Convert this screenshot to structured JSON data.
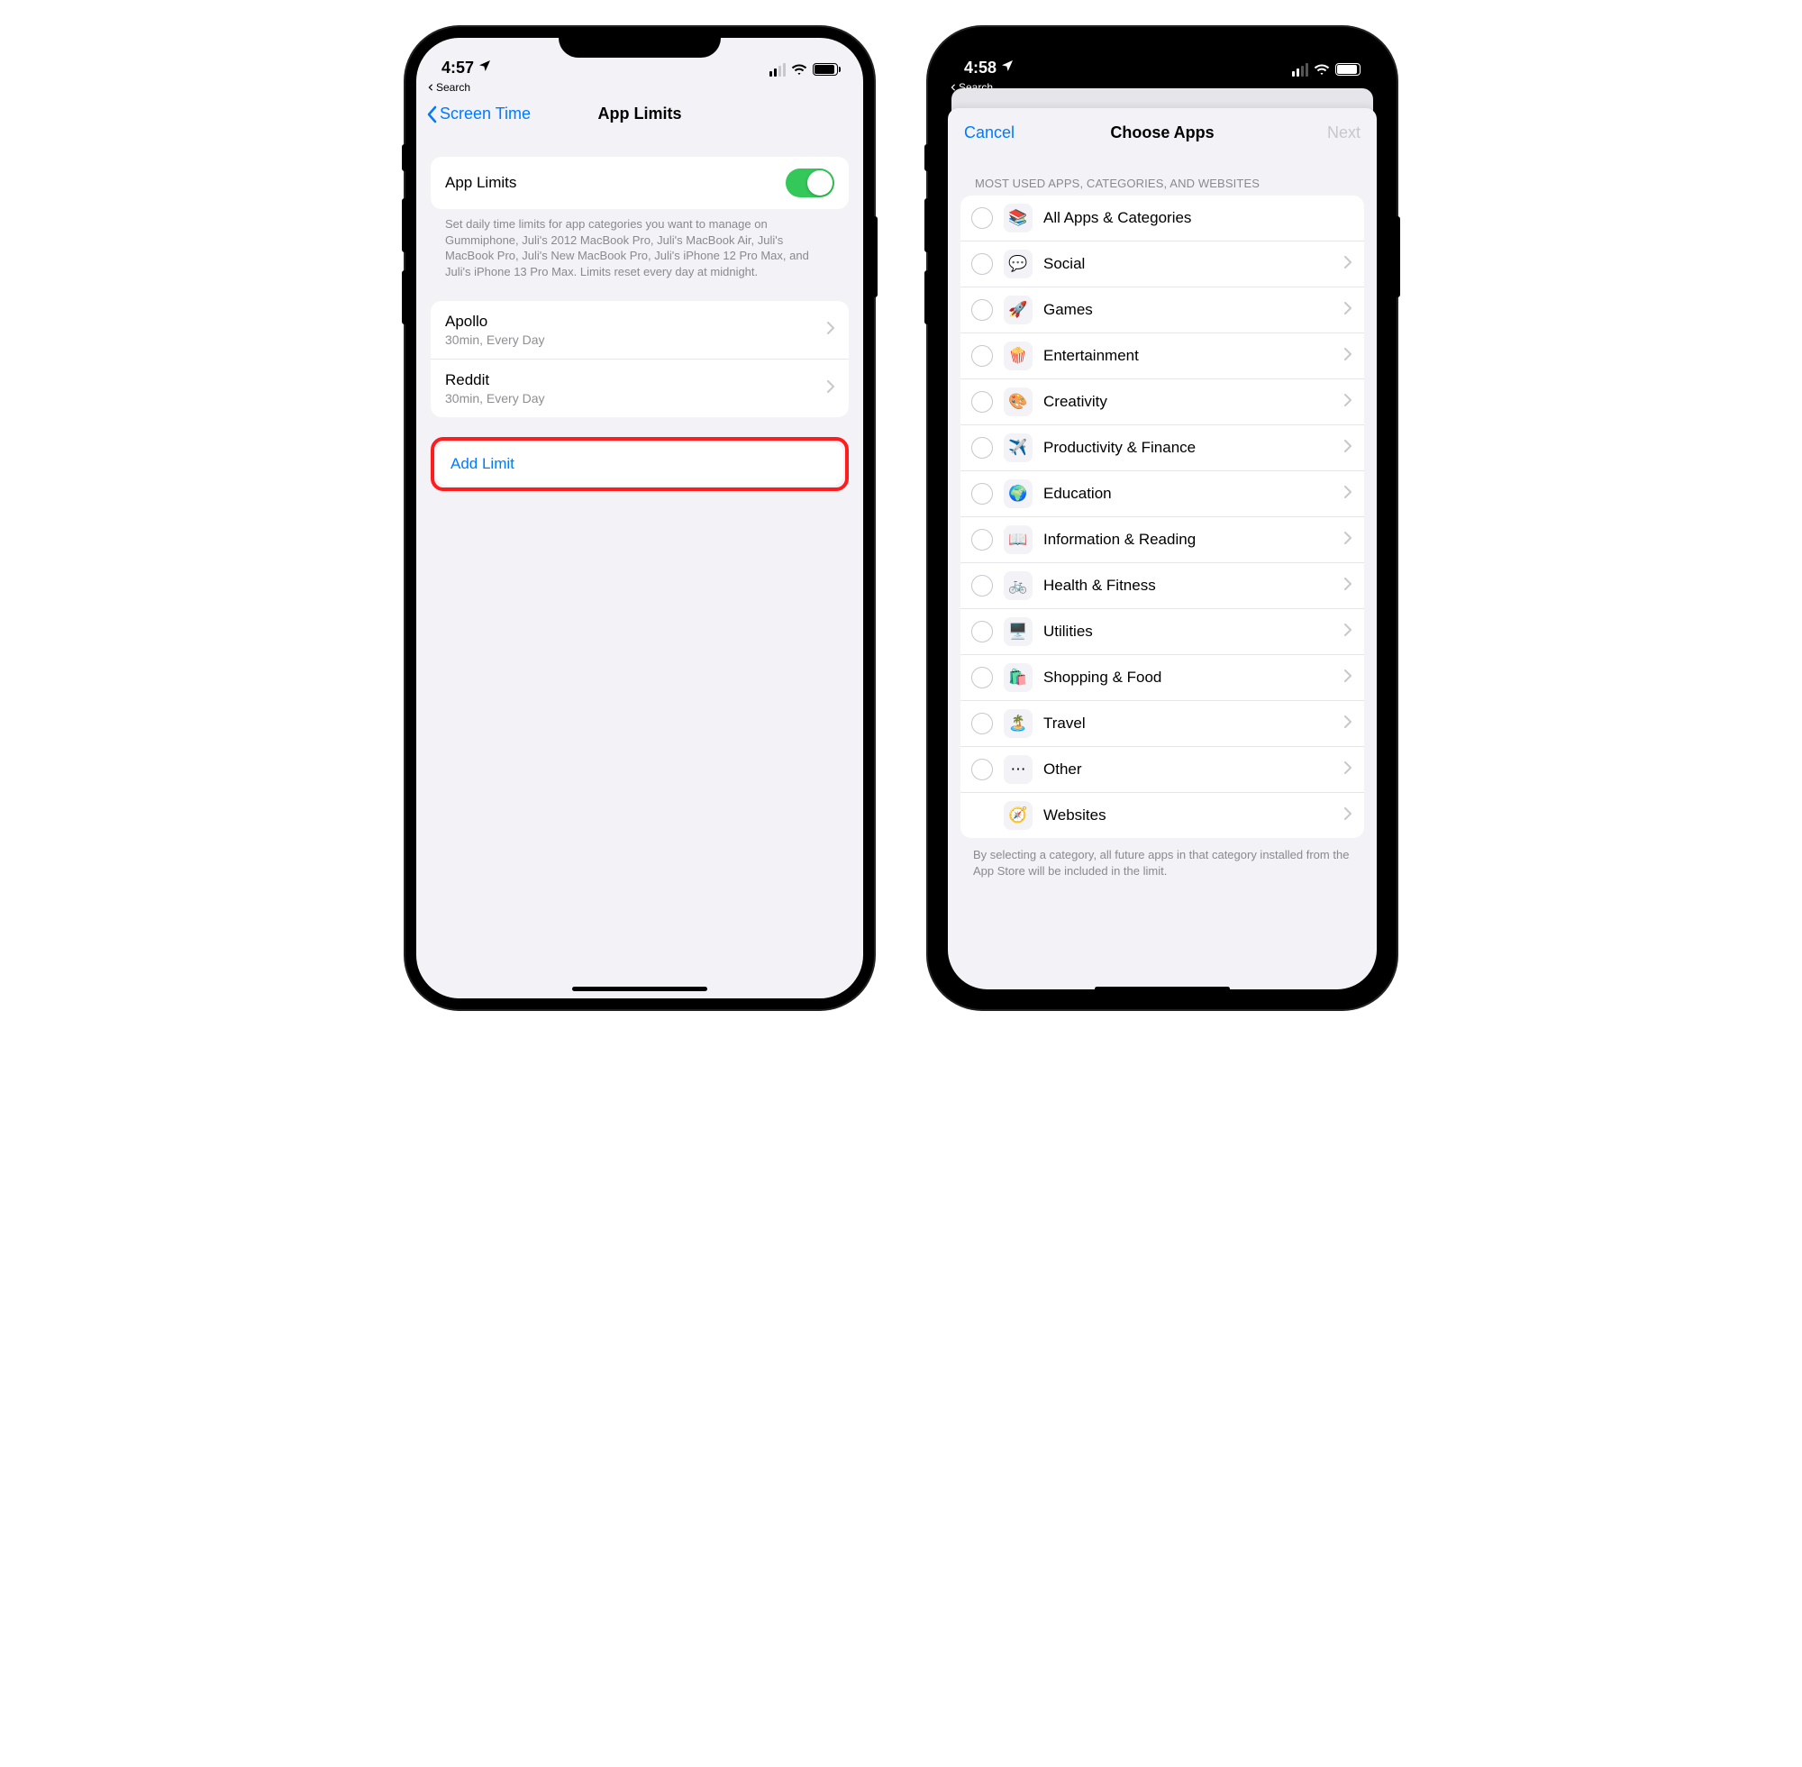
{
  "left": {
    "status": {
      "time": "4:57"
    },
    "breadcrumb": "Search",
    "nav": {
      "back": "Screen Time",
      "title": "App Limits"
    },
    "toggle_label": "App Limits",
    "description": "Set daily time limits for app categories you want to manage on Gummiphone, Juli's 2012 MacBook Pro, Juli's MacBook Air, Juli's MacBook Pro, Juli's New MacBook Pro, Juli's iPhone 12 Pro Max, and Juli's iPhone 13 Pro Max. Limits reset every day at midnight.",
    "limits": [
      {
        "name": "Apollo",
        "detail": "30min, Every Day"
      },
      {
        "name": "Reddit",
        "detail": "30min, Every Day"
      }
    ],
    "add_label": "Add Limit"
  },
  "right": {
    "status": {
      "time": "4:58"
    },
    "breadcrumb": "Search",
    "nav": {
      "cancel": "Cancel",
      "title": "Choose Apps",
      "next": "Next"
    },
    "section_header": "MOST USED APPS, CATEGORIES, AND WEBSITES",
    "categories": [
      {
        "label": "All Apps & Categories",
        "icon": "📚",
        "chevron": false,
        "radio": true
      },
      {
        "label": "Social",
        "icon": "💬",
        "chevron": true,
        "radio": true
      },
      {
        "label": "Games",
        "icon": "🚀",
        "chevron": true,
        "radio": true
      },
      {
        "label": "Entertainment",
        "icon": "🍿",
        "chevron": true,
        "radio": true
      },
      {
        "label": "Creativity",
        "icon": "🎨",
        "chevron": true,
        "radio": true
      },
      {
        "label": "Productivity & Finance",
        "icon": "✈️",
        "chevron": true,
        "radio": true
      },
      {
        "label": "Education",
        "icon": "🌍",
        "chevron": true,
        "radio": true
      },
      {
        "label": "Information & Reading",
        "icon": "📖",
        "chevron": true,
        "radio": true
      },
      {
        "label": "Health & Fitness",
        "icon": "🚲",
        "chevron": true,
        "radio": true
      },
      {
        "label": "Utilities",
        "icon": "🖥️",
        "chevron": true,
        "radio": true
      },
      {
        "label": "Shopping & Food",
        "icon": "🛍️",
        "chevron": true,
        "radio": true
      },
      {
        "label": "Travel",
        "icon": "🏝️",
        "chevron": true,
        "radio": true
      },
      {
        "label": "Other",
        "icon": "⋯",
        "chevron": true,
        "radio": true
      },
      {
        "label": "Websites",
        "icon": "🧭",
        "chevron": true,
        "radio": false
      }
    ],
    "footer": "By selecting a category, all future apps in that category installed from the App Store will be included in the limit."
  }
}
